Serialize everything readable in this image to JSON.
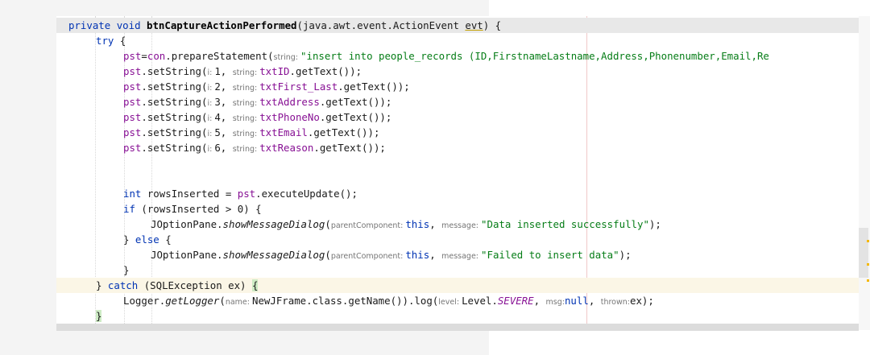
{
  "editor": {
    "line1": {
      "kw_private": "private",
      "kw_void": "void",
      "method": "btnCaptureActionPerformed",
      "params": "(java.awt.event.ActionEvent ",
      "evt": "evt",
      "close": ") {"
    },
    "line2": {
      "kw_try": "try",
      "brace": " {"
    },
    "line3": {
      "pst": "pst",
      "eq": "=",
      "con": "con",
      "call": ".prepareStatement(",
      "hint": "string: ",
      "value": "\"insert into people_records (ID,FirstnameLastname,Address,Phonenumber,Email,Re"
    },
    "set_lines": [
      {
        "pst": "pst",
        "call": ".setString(",
        "hint_i": "i: ",
        "index": "1",
        "comma": ", ",
        "hint_s": "string: ",
        "field": "txtID",
        "tail": ".getText());"
      },
      {
        "pst": "pst",
        "call": ".setString(",
        "hint_i": "i: ",
        "index": "2",
        "comma": ", ",
        "hint_s": "string: ",
        "field": "txtFirst_Last",
        "tail": ".getText());"
      },
      {
        "pst": "pst",
        "call": ".setString(",
        "hint_i": "i: ",
        "index": "3",
        "comma": ", ",
        "hint_s": "string: ",
        "field": "txtAddress",
        "tail": ".getText());"
      },
      {
        "pst": "pst",
        "call": ".setString(",
        "hint_i": "i: ",
        "index": "4",
        "comma": ", ",
        "hint_s": "string: ",
        "field": "txtPhoneNo",
        "tail": ".getText());"
      },
      {
        "pst": "pst",
        "call": ".setString(",
        "hint_i": "i: ",
        "index": "5",
        "comma": ", ",
        "hint_s": "string: ",
        "field": "txtEmail",
        "tail": ".getText());"
      },
      {
        "pst": "pst",
        "call": ".setString(",
        "hint_i": "i: ",
        "index": "6",
        "comma": ", ",
        "hint_s": "string: ",
        "field": "txtReason",
        "tail": ".getText());"
      }
    ],
    "line_rows": {
      "kw_int": "int",
      "rest": " rowsInserted = ",
      "pst": "pst",
      "tail": ".executeUpdate();"
    },
    "line_if": {
      "kw_if": "if",
      "rest": " (rowsInserted > 0) {"
    },
    "line_success": {
      "cls": "JOptionPane.",
      "method": "showMessageDialog",
      "open": "(",
      "hint_parent": "parentComponent: ",
      "this": "this",
      "comma": ", ",
      "hint_msg": "message: ",
      "msg": "\"Data inserted successfully\"",
      "close": ");"
    },
    "line_else": {
      "pre": "} ",
      "kw_else": "else",
      "post": " {"
    },
    "line_fail": {
      "cls": "JOptionPane.",
      "method": "showMessageDialog",
      "open": "(",
      "hint_parent": "parentComponent: ",
      "this": "this",
      "comma": ", ",
      "hint_msg": "message: ",
      "msg": "\"Failed to insert data\"",
      "close": ");"
    },
    "line_close_if": "}",
    "line_catch": {
      "pre": "} ",
      "kw_catch": "catch",
      "rest": " (SQLException ex) ",
      "brace": "{"
    },
    "line_logger": {
      "cls": "Logger.",
      "method": "getLogger",
      "open": "(",
      "hint_name": "name: ",
      "arg": "NewJFrame.class.getName()).log(",
      "hint_level": "level: ",
      "level_cls": "Level.",
      "level": "SEVERE",
      "comma1": ", ",
      "hint_msg": "msg:",
      "null": "null",
      "comma2": ", ",
      "hint_thrown": "thrown:",
      "ex": "ex",
      "close": ");"
    },
    "line_close_catch": "}"
  }
}
